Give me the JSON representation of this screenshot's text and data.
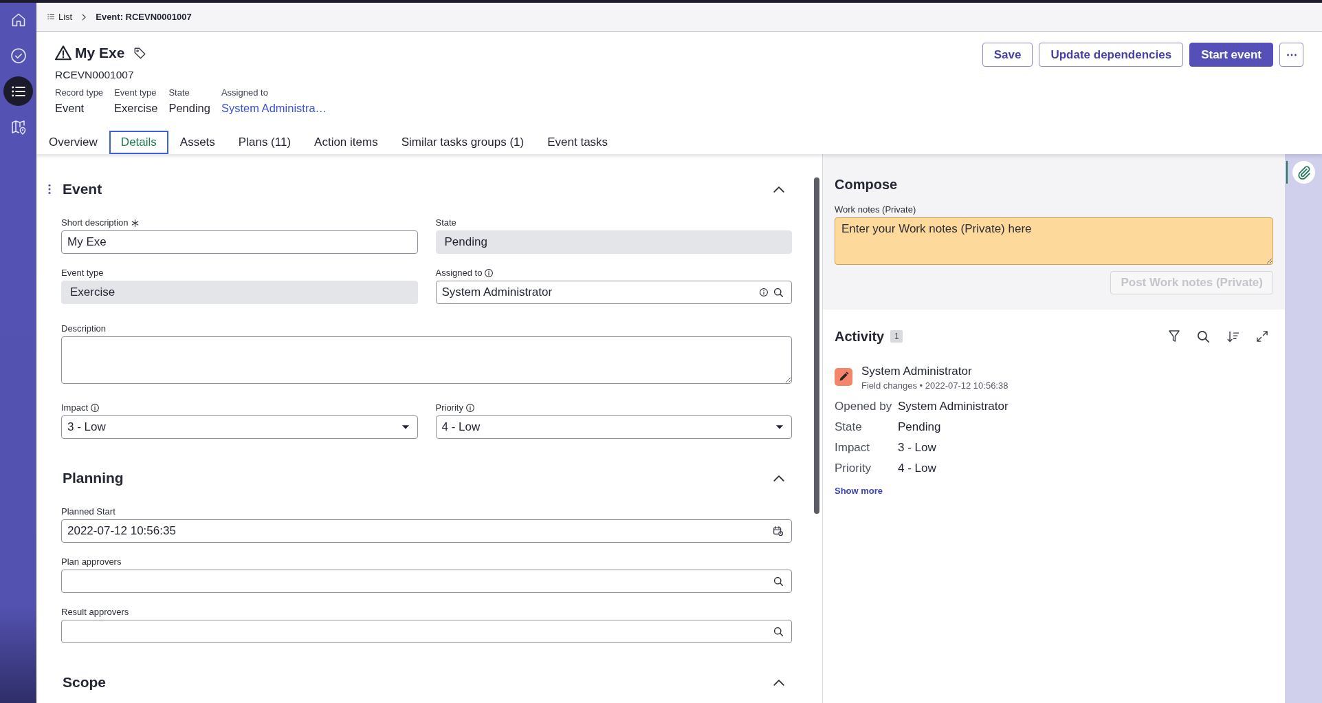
{
  "sidebar": {
    "items": [
      {
        "selected": false
      },
      {
        "selected": false
      },
      {
        "selected": true
      },
      {
        "selected": false
      }
    ]
  },
  "breadcrumb": [
    {
      "label": "List",
      "current": false
    },
    {
      "label": "Event: RCEVN0001007",
      "current": true
    }
  ],
  "record": {
    "title": "My Exe",
    "number": "RCEVN0001007",
    "summary": [
      {
        "label": "Record type",
        "value": "Event",
        "kind": "text"
      },
      {
        "label": "Event type",
        "value": "Exercise",
        "kind": "text"
      },
      {
        "label": "State",
        "value": "Pending",
        "kind": "text"
      },
      {
        "label": "Assigned to",
        "value": "System Administra…",
        "kind": "link"
      }
    ],
    "actions": [
      {
        "label": "Save",
        "kind": "secondary"
      },
      {
        "label": "Update dependencies",
        "kind": "secondary"
      },
      {
        "label": "Start event",
        "kind": "primary"
      },
      {
        "kind": "more"
      }
    ]
  },
  "tabs": [
    {
      "label": "Overview",
      "selected": false
    },
    {
      "label": "Details",
      "selected": true
    },
    {
      "label": "Assets",
      "selected": false
    },
    {
      "label": "Plans (11)",
      "selected": false
    },
    {
      "label": "Action items",
      "selected": false
    },
    {
      "label": "Similar tasks groups (1)",
      "selected": false
    },
    {
      "label": "Event tasks",
      "selected": false
    }
  ],
  "form": {
    "sections": [
      {
        "title": "Event",
        "expanded": true,
        "drag_handle": true,
        "rows": [
          [
            {
              "label": "Short description",
              "kind": "text",
              "required": true,
              "info": false,
              "readonly": false,
              "value": "My Exe"
            },
            {
              "label": "State",
              "kind": "text",
              "required": false,
              "info": false,
              "readonly": true,
              "value": "Pending"
            }
          ],
          [
            {
              "label": "Event type",
              "kind": "text",
              "required": false,
              "info": false,
              "readonly": true,
              "value": "Exercise"
            },
            {
              "label": "Assigned to",
              "kind": "reference",
              "required": false,
              "info": true,
              "readonly": false,
              "value": "System Administrator"
            }
          ],
          [
            {
              "label": "Description",
              "kind": "textarea",
              "required": false,
              "info": false,
              "readonly": false
            }
          ],
          [
            {
              "label": "Impact",
              "kind": "select",
              "required": false,
              "info": true,
              "readonly": false,
              "value": "3 - Low"
            },
            {
              "label": "Priority",
              "kind": "select",
              "required": false,
              "info": true,
              "readonly": false,
              "value": "4 - Low"
            }
          ]
        ]
      },
      {
        "title": "Planning",
        "expanded": true,
        "drag_handle": false,
        "rows": [
          [
            {
              "label": "Planned Start",
              "kind": "date",
              "required": false,
              "info": false,
              "readonly": false,
              "value": "2022-07-12 10:56:35"
            }
          ],
          [
            {
              "label": "Plan approvers",
              "kind": "reference",
              "required": false,
              "info": false,
              "readonly": false
            }
          ],
          [
            {
              "label": "Result approvers",
              "kind": "reference",
              "required": false,
              "info": false,
              "readonly": false
            }
          ]
        ]
      },
      {
        "title": "Scope",
        "expanded": true,
        "drag_handle": false
      }
    ]
  },
  "compose": {
    "title": "Compose",
    "label": "Work notes (Private)",
    "placeholder": "Enter your Work notes (Private) here",
    "post_button": {
      "label": "Post Work notes (Private)",
      "disabled": true
    }
  },
  "activity": {
    "title": "Activity",
    "count": "1",
    "entries": [
      {
        "author": "System Administrator",
        "meta": "Field changes • 2022-07-12 10:56:38",
        "changes": [
          {
            "label": "Opened by",
            "value": "System Administrator"
          },
          {
            "label": "State",
            "value": "Pending"
          },
          {
            "label": "Impact",
            "value": "3 - Low"
          },
          {
            "label": "Priority",
            "value": "4 - Low"
          }
        ]
      }
    ],
    "show_more": "Show more"
  },
  "rail": {
    "items": [
      {
        "selected": true
      }
    ]
  }
}
